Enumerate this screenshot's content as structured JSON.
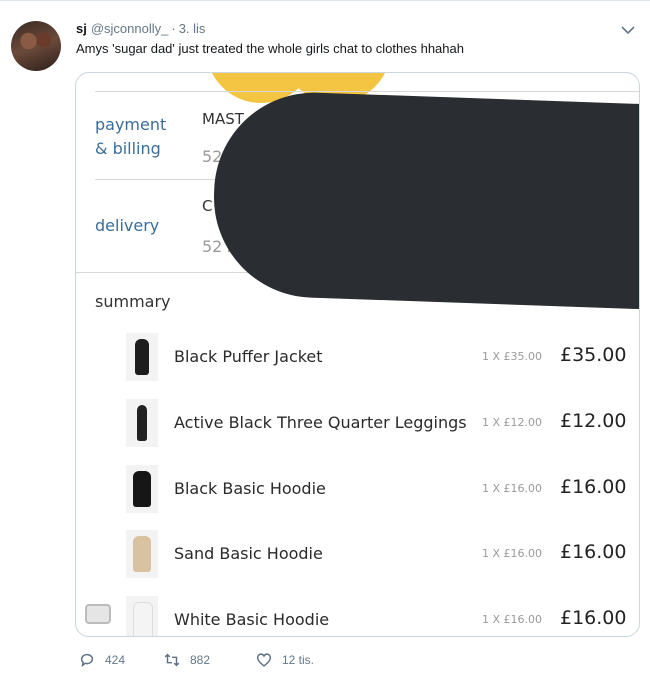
{
  "tweet": {
    "display_name": "sj",
    "handle": "@sjconnolly_",
    "separator": "·",
    "date": "3. lis",
    "text": "Amys 'sugar dad' just treated the whole girls chat to clothes hhahah",
    "actions": {
      "replies": "424",
      "retweets": "882",
      "likes": "12 tis."
    }
  },
  "media": {
    "payment_label": "payment\n& billing",
    "payment_value_line1": "MAST",
    "payment_value_line2": "52",
    "delivery_label": "delivery",
    "delivery_value_line1": "C",
    "delivery_value_line2": "52 A",
    "summary_title": "summary",
    "items": [
      {
        "name": "Black Puffer Jacket",
        "qty": "1 X £35.00",
        "price": "£35.00",
        "color": "#1d1d1d"
      },
      {
        "name": "Active Black Three Quarter Leggings",
        "qty": "1 X £12.00",
        "price": "£12.00",
        "color": "#222222"
      },
      {
        "name": "Black Basic Hoodie",
        "qty": "1 X £16.00",
        "price": "£16.00",
        "color": "#161616"
      },
      {
        "name": "Sand Basic Hoodie",
        "qty": "1 X £16.00",
        "price": "£16.00",
        "color": "#d9c2a1"
      },
      {
        "name": "White Basic Hoodie",
        "qty": "1 X £16.00",
        "price": "£16.00",
        "color": "#f4f4f4"
      }
    ]
  },
  "colors": {
    "accent_link": "#3b6d9a",
    "muted": "#657786",
    "redaction": "#2a2d31",
    "emoji": "#f4c542"
  }
}
